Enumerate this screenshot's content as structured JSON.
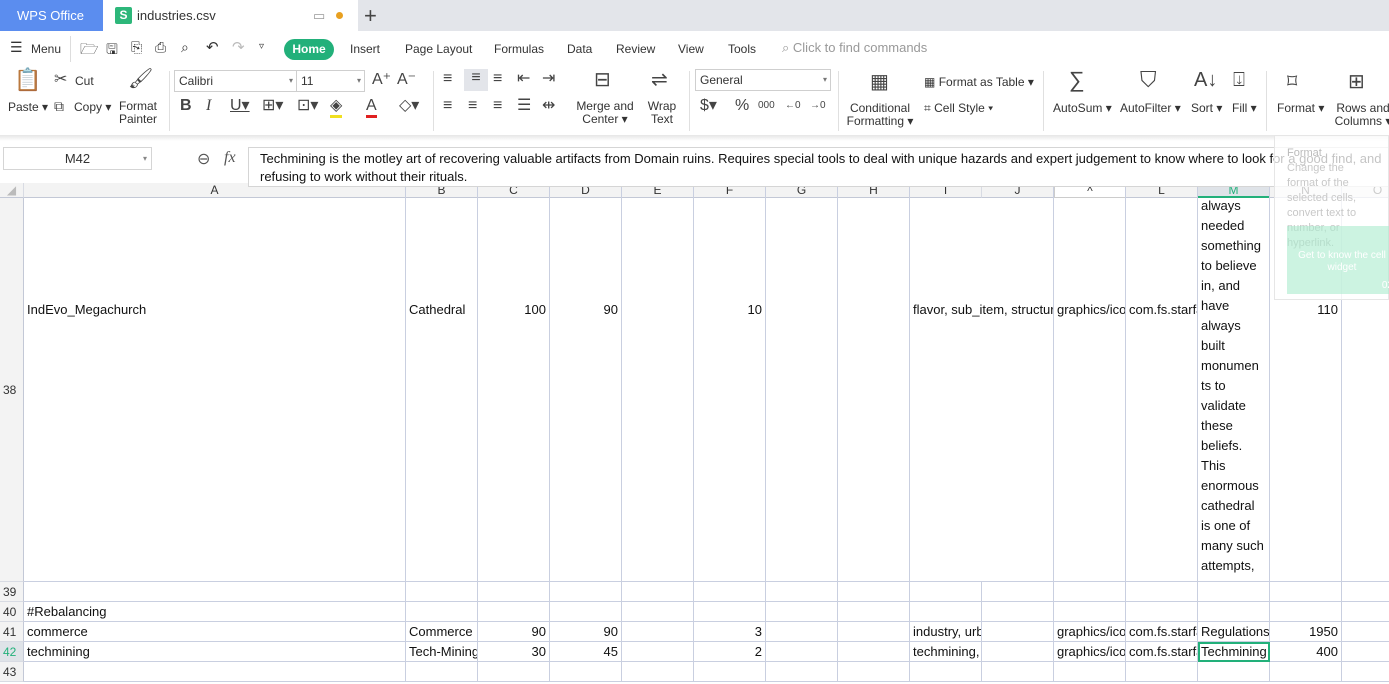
{
  "app": {
    "name": "WPS Office",
    "file_tab": "industries.csv",
    "file_icon": "S",
    "new_tab": "+",
    "accent": "#22b07a"
  },
  "menu": {
    "menu_label": "Menu",
    "tabs": [
      "Home",
      "Insert",
      "Page Layout",
      "Formulas",
      "Data",
      "Review",
      "View",
      "Tools"
    ],
    "search_placeholder": "Click to find commands"
  },
  "ribbon": {
    "paste": "Paste",
    "cut": "Cut",
    "copy": "Copy",
    "format_painter": [
      "Format",
      "Painter"
    ],
    "font": "Calibri",
    "font_size": "11",
    "merge": [
      "Merge and",
      "Center"
    ],
    "wrap": [
      "Wrap",
      "Text"
    ],
    "number_format": "General",
    "conditional": [
      "Conditional",
      "Formatting"
    ],
    "format_as_table": "Format as Table",
    "cell_style": "Cell Style",
    "autosum": "AutoSum",
    "autofilter": "AutoFilter",
    "sort": "Sort",
    "fill": "Fill",
    "format": "Format",
    "rows_columns": [
      "Rows and",
      "Columns"
    ]
  },
  "formula_bar": {
    "cell_ref": "M42",
    "fx": "fx",
    "content": "Techmining is the motley art of recovering valuable artifacts from Domain ruins. Requires special tools to deal with unique hazards and expert judgement to know where to look for a good find, and refusing to work without their rituals."
  },
  "tooltip": {
    "title": "Format",
    "text": "Change the format of the selected cells, convert text to number, or hyperlink.",
    "card": "Get to know the cell widget",
    "card_badge": "02"
  },
  "sheet": {
    "columns": [
      "A",
      "B",
      "C",
      "D",
      "E",
      "F",
      "G",
      "H",
      "I",
      "J",
      "K",
      "L",
      "M",
      "N",
      "O"
    ],
    "active_column": "M",
    "active_row": "42",
    "rows": [
      {
        "num": "38",
        "cells": {
          "A": "IndEvo_Megachurch",
          "B": "Cathedral",
          "C": "100",
          "D": "90",
          "F": "10",
          "I": "flavor, sub_item, structure",
          "K": "graphics/icons",
          "L": "com.fs.starfarer",
          "M": "always needed something to believe in, and have always built monumen ts to validate these beliefs. This enormous cathedral is one of many such attempts,",
          "N": "110"
        }
      },
      {
        "num": "39",
        "cells": {}
      },
      {
        "num": "40",
        "cells": {
          "A": "#Rebalancing"
        }
      },
      {
        "num": "41",
        "cells": {
          "A": "commerce",
          "B": "Commerce",
          "C": "90",
          "D": "90",
          "F": "3",
          "I": "industry, urban",
          "K": "graphics/icons",
          "L": "com.fs.starfarer",
          "M": "Regulations",
          "N": "1950"
        }
      },
      {
        "num": "42",
        "cells": {
          "A": "techmining",
          "B": "Tech-Mining",
          "C": "30",
          "D": "45",
          "F": "2",
          "I": "techmining, industry, industrial",
          "K": "graphics/icons",
          "L": "com.fs.starfarer",
          "M": "Techmining",
          "N": "400"
        }
      },
      {
        "num": "43",
        "cells": {}
      }
    ],
    "m38_lines": [
      "always",
      "needed",
      "something",
      "to believe",
      "in, and",
      "have",
      "always",
      "built",
      "monumen",
      "ts to",
      "validate",
      "these",
      "beliefs.",
      "This",
      "enormous",
      "cathedral",
      "is one of",
      "many such",
      "attempts,"
    ]
  }
}
